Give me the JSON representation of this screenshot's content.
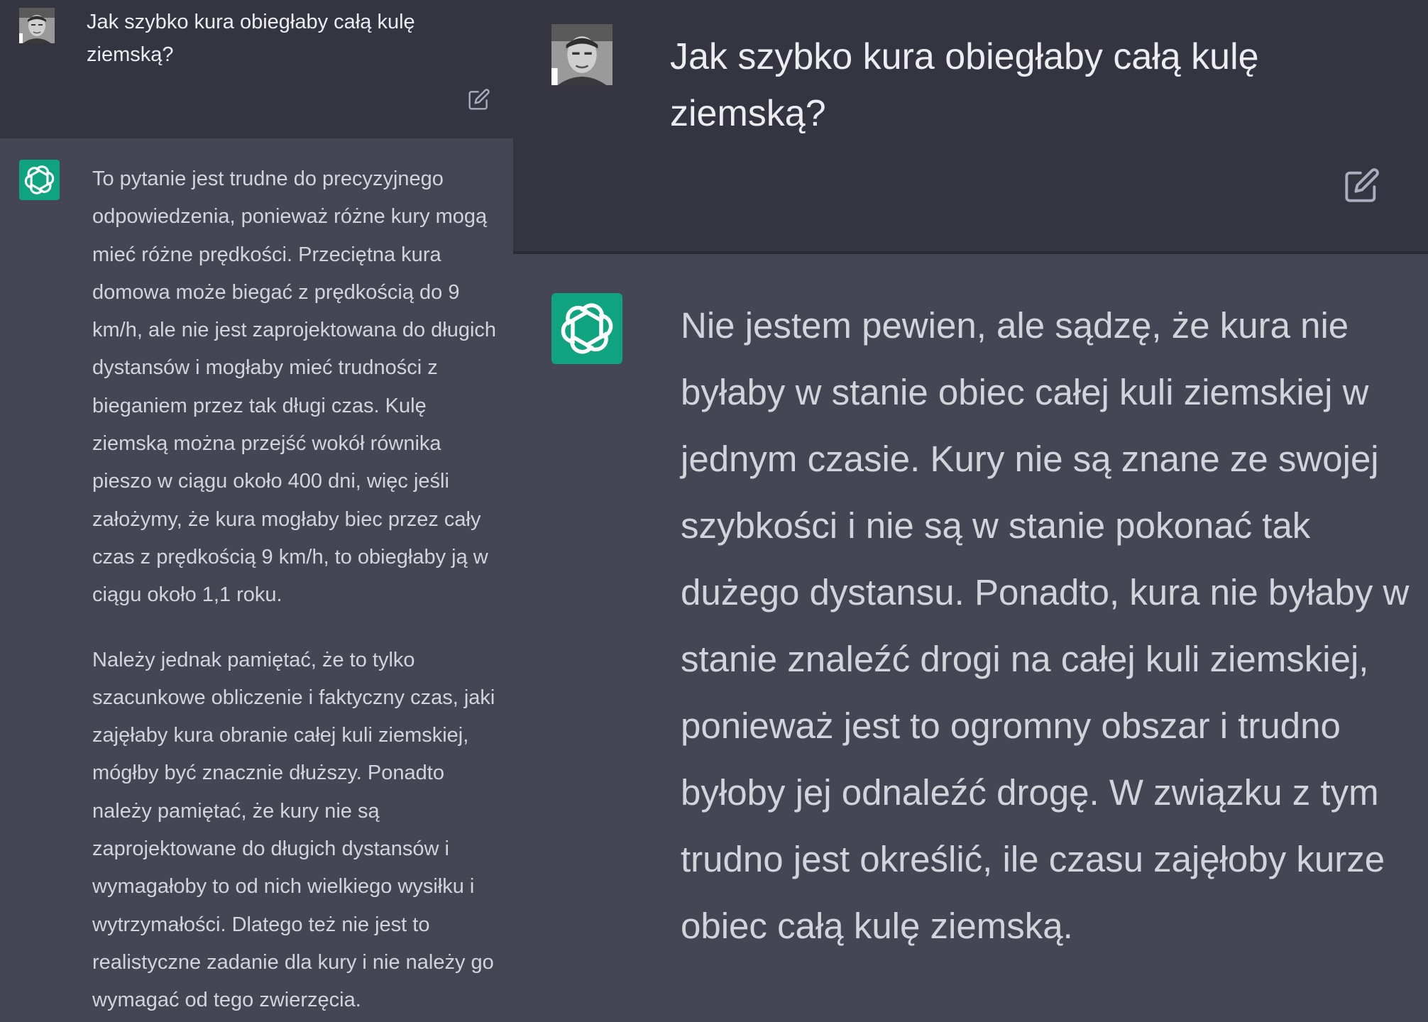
{
  "left": {
    "user_message": "Jak szybko kura obiegłaby całą kulę ziemską?",
    "assistant_paragraphs": [
      "To pytanie jest trudne do precyzyjnego odpowiedzenia, ponieważ różne kury mogą mieć różne prędkości. Przeciętna kura domowa może biegać z prędkością do 9 km/h, ale nie jest zaprojektowana do długich dystansów i mogłaby mieć trudności z bieganiem przez tak długi czas. Kulę ziemską można przejść wokół równika pieszo w ciągu około 400 dni, więc jeśli założymy, że kura mogłaby biec przez cały czas z prędkością 9 km/h, to obiegłaby ją w ciągu około 1,1 roku.",
      "Należy jednak pamiętać, że to tylko szacunkowe obliczenie i faktyczny czas, jaki zajęłaby kura obranie całej kuli ziemskiej, mógłby być znacznie dłuższy. Ponadto należy pamiętać, że kury nie są zaprojektowane do długich dystansów i wymagałoby to od nich wielkiego wysiłku i wytrzymałości. Dlatego też nie jest to realistyczne zadanie dla kury i nie należy go wymagać od tego zwierzęcia."
    ]
  },
  "right": {
    "user_message": "Jak szybko kura obiegłaby całą kulę ziemską?",
    "assistant_paragraphs": [
      "Nie jestem pewien, ale sądzę, że kura nie byłaby w stanie obiec całej kuli ziemskiej w jednym czasie. Kury nie są znane ze swojej szybkości i nie są w stanie pokonać tak dużego dystansu. Ponadto, kura nie byłaby w stanie znaleźć drogi na całej kuli ziemskiej, ponieważ jest to ogromny obszar i trudno byłoby jej odnaleźć drogę. W związku z tym trudno jest określić, ile czasu zajęłoby kurze obiec całą kulę ziemską."
    ]
  },
  "icons": {
    "user": "user-avatar",
    "edit": "edit-icon",
    "assistant": "openai-logo-icon"
  },
  "colors": {
    "user_row_bg": "#343541",
    "assistant_row_bg": "#444654",
    "assistant_logo_bg": "#10a37f",
    "user_text": "#ececf1",
    "assistant_text": "#d1d5db",
    "icon": "#acacbe"
  }
}
